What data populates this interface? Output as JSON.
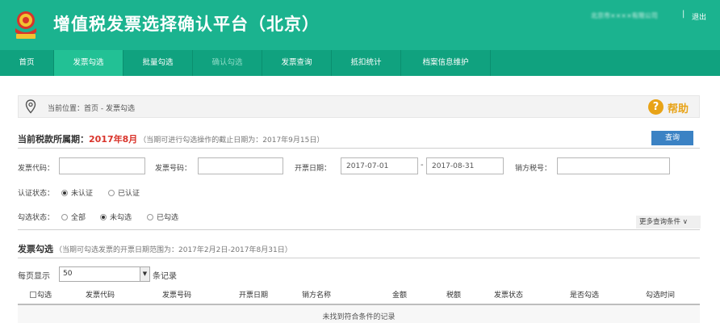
{
  "header": {
    "title": "增值税发票选择确认平台（北京）",
    "user": "北京市××××有限公司",
    "separator": "|",
    "logout": "退出",
    "bg_color": "#1bb38f"
  },
  "nav": {
    "items": [
      {
        "label": "首页"
      },
      {
        "label": "发票勾选"
      },
      {
        "label": "批量勾选"
      },
      {
        "label": "确认勾选"
      },
      {
        "label": "发票查询"
      },
      {
        "label": "抵扣统计"
      },
      {
        "label": "档案信息维护"
      }
    ],
    "bg_color": "#10a27f",
    "active_color": "#22c195"
  },
  "breadcrumb": {
    "text": "当前位置：首页 - 发票勾选",
    "help_glyph": "?",
    "help": "帮助",
    "help_color": "#e8a317"
  },
  "period": {
    "label": "当前税款所属期：",
    "value": "2017年8月",
    "note": "（当期可进行勾选操作的截止日期为：2017年9月15日）",
    "value_color": "#d9342b"
  },
  "query_button": "查询",
  "filters": {
    "invoice_code_label": "发票代码：",
    "invoice_number_label": "发票号码：",
    "date_label": "开票日期：",
    "date_from": "2017-07-01",
    "date_sep": "-",
    "date_to": "2017-08-31",
    "seller_tax_label": "销方税号：",
    "auth_label": "认证状态：",
    "auth_options": [
      "未认证",
      "已认证"
    ],
    "select_label": "勾选状态：",
    "select_options": [
      "全部",
      "未勾选",
      "已勾选"
    ],
    "more": "更多查询条件 ∨"
  },
  "section": {
    "title": "发票勾选",
    "note": "（当期可勾选发票的开票日期范围为：2017年2月2日-2017年8月31日）"
  },
  "pager": {
    "prefix": "每页显示",
    "value": "50",
    "suffix": "条记录"
  },
  "table": {
    "headers": [
      "勾选",
      "发票代码",
      "发票号码",
      "开票日期",
      "销方名称",
      "金额",
      "税额",
      "发票状态",
      "是否勾选",
      "勾选时间"
    ],
    "empty": "未找到符合条件的记录"
  }
}
